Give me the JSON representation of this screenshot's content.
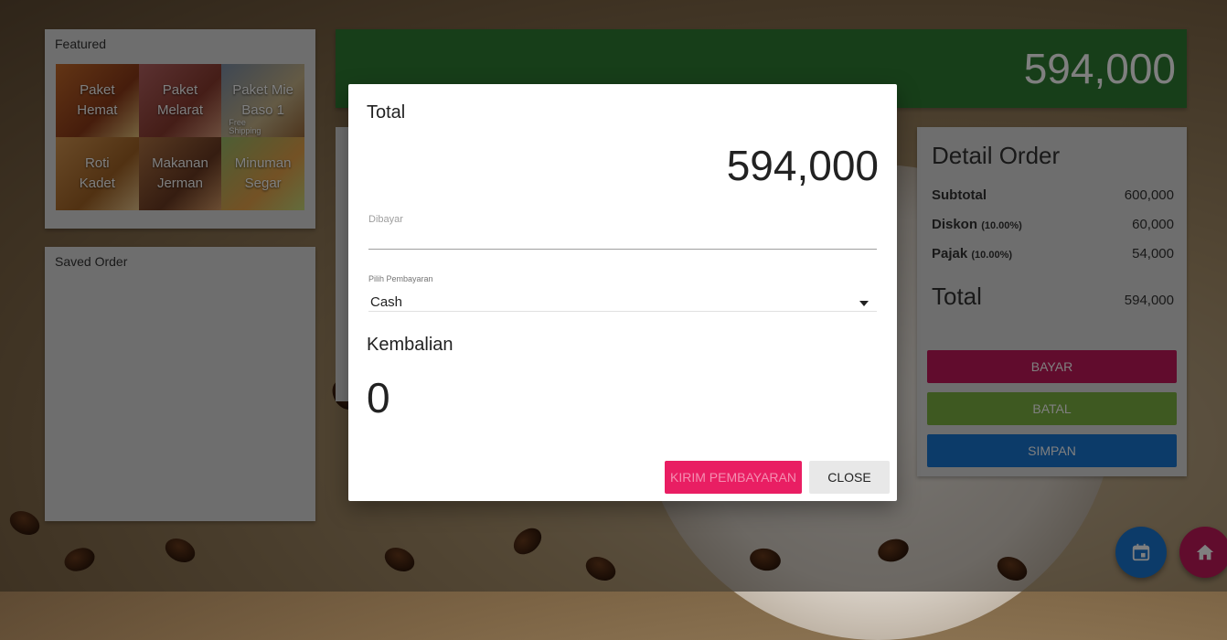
{
  "featured": {
    "title": "Featured",
    "items": [
      {
        "line1": "Paket",
        "line2": "Hemat"
      },
      {
        "line1": "Paket",
        "line2": "Melarat"
      },
      {
        "line1": "Paket Mie",
        "line2": "Baso 1",
        "badge": "Free Shipping"
      },
      {
        "line1": "Roti",
        "line2": "Kadet"
      },
      {
        "line1": "Makanan",
        "line2": "Jerman"
      },
      {
        "line1": "Minuman",
        "line2": "Segar"
      }
    ]
  },
  "saved_order": {
    "title": "Saved Order"
  },
  "header_total": "594,000",
  "detail_order": {
    "title": "Detail Order",
    "subtotal_label": "Subtotal",
    "subtotal_value": "600,000",
    "diskon_label": "Diskon",
    "diskon_pct": "(10.00%)",
    "diskon_value": "60,000",
    "pajak_label": "Pajak",
    "pajak_pct": "(10.00%)",
    "pajak_value": "54,000",
    "total_label": "Total",
    "total_value": "594,000",
    "buttons": {
      "bayar": "BAYAR",
      "batal": "BATAL",
      "simpan": "SIMPAN"
    }
  },
  "modal": {
    "title": "Total",
    "total_value": "594,000",
    "dibayar_label": "Dibayar",
    "dibayar_value": "",
    "payment_label": "Pilih Pembayaran",
    "payment_selected": "Cash",
    "kembalian_label": "Kembalian",
    "kembalian_value": "0",
    "kirim_label": "KIRIM PEMBAYARAN",
    "close_label": "CLOSE"
  },
  "colors": {
    "header_green": "#2e7d32",
    "bayar": "#c2185b",
    "batal": "#7cb342",
    "simpan": "#1976d2",
    "kirim": "#e91e63"
  },
  "fab": {
    "calendar_icon": "calendar-icon",
    "home_icon": "home-icon"
  }
}
